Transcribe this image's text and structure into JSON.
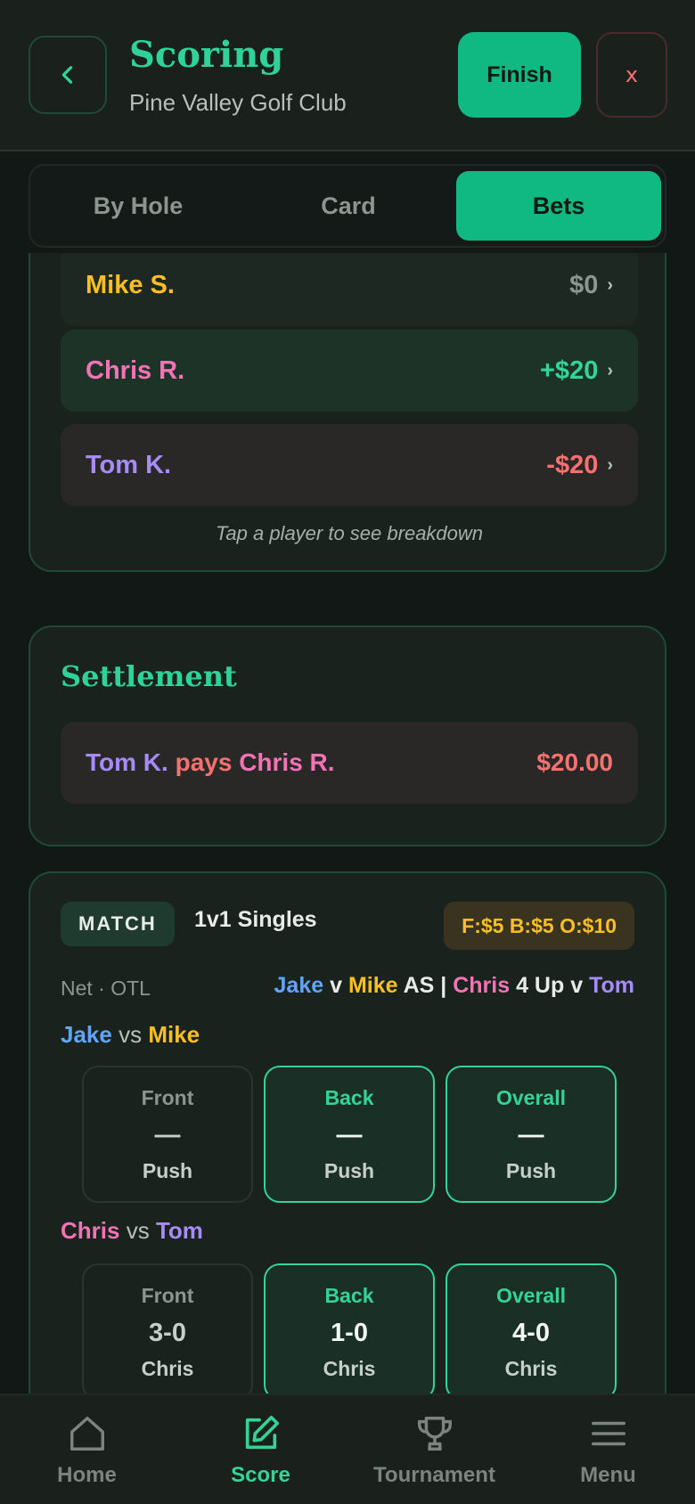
{
  "header": {
    "back_icon": "chevron-left-icon",
    "title": "Scoring",
    "subtitle": "Pine Valley Golf Club",
    "finish_label": "Finish",
    "close_label": "x"
  },
  "tabs": [
    {
      "label": "By Hole",
      "active": false
    },
    {
      "label": "Card",
      "active": false
    },
    {
      "label": "Bets",
      "active": true
    }
  ],
  "standings": {
    "players": [
      {
        "name": "Mike S.",
        "amount": "$0",
        "tone": "neutral"
      },
      {
        "name": "Chris R.",
        "amount": "+$20",
        "tone": "positive"
      },
      {
        "name": "Tom K.",
        "amount": "-$20",
        "tone": "negative"
      }
    ],
    "chevron": "›",
    "hint": "Tap a player to see breakdown"
  },
  "settlement": {
    "title": "Settlement",
    "payer": "Tom K.",
    "verb": "pays",
    "payee": "Chris R.",
    "amount": "$20.00"
  },
  "match": {
    "badge": "MATCH",
    "name": "1v1 Singles",
    "stakes": "F:$5 B:$5 O:$10",
    "meta": "Net · OTL",
    "summary": {
      "p1": "Jake",
      "v1": "v",
      "p2": "Mike",
      "s1": "AS",
      "sep": "|",
      "p3": "Chris",
      "s2": "4 Up",
      "v2": "v",
      "p4": "Tom"
    },
    "pairs": [
      {
        "a": "Jake",
        "vs": "vs",
        "b": "Mike",
        "segments": [
          {
            "label": "Front",
            "value": "—",
            "result": "Push"
          },
          {
            "label": "Back",
            "value": "—",
            "result": "Push"
          },
          {
            "label": "Overall",
            "value": "—",
            "result": "Push"
          }
        ]
      },
      {
        "a": "Chris",
        "vs": "vs",
        "b": "Tom",
        "segments": [
          {
            "label": "Front",
            "value": "3-0",
            "result": "Chris"
          },
          {
            "label": "Back",
            "value": "1-0",
            "result": "Chris"
          },
          {
            "label": "Overall",
            "value": "4-0",
            "result": "Chris"
          }
        ]
      }
    ]
  },
  "nav": [
    {
      "label": "Home",
      "icon": "home-icon",
      "active": false
    },
    {
      "label": "Score",
      "icon": "edit-icon",
      "active": true
    },
    {
      "label": "Tournament",
      "icon": "trophy-icon",
      "active": false
    },
    {
      "label": "Menu",
      "icon": "menu-icon",
      "active": false
    }
  ],
  "colors": {
    "accent": "#10b981",
    "jake": "#60a5fa",
    "mike": "#fbbf24",
    "chris": "#f472b6",
    "tom": "#a78bfa",
    "positive": "#34d399",
    "negative": "#f87171"
  }
}
